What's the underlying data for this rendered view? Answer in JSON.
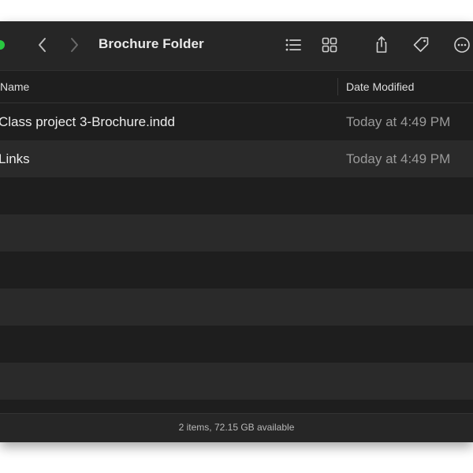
{
  "window": {
    "title": "Brochure Folder"
  },
  "toolbar": {
    "icons": [
      "back-chevron-icon",
      "forward-chevron-icon",
      "list-view-icon",
      "grid-view-icon",
      "share-icon",
      "tag-icon",
      "more-icon"
    ]
  },
  "columns": {
    "name": "Name",
    "date_modified": "Date Modified"
  },
  "files": [
    {
      "name": "Class project 3-Brochure.indd",
      "date": "Today at 4:49 PM"
    },
    {
      "name": "Links",
      "date": "Today at 4:49 PM"
    }
  ],
  "status": {
    "text": "2 items, 72.15 GB available"
  },
  "colors": {
    "background": "#1e1e1e",
    "toolbar": "#262626",
    "stripe": "#2a2a2a",
    "traffic_green": "#29c740"
  }
}
